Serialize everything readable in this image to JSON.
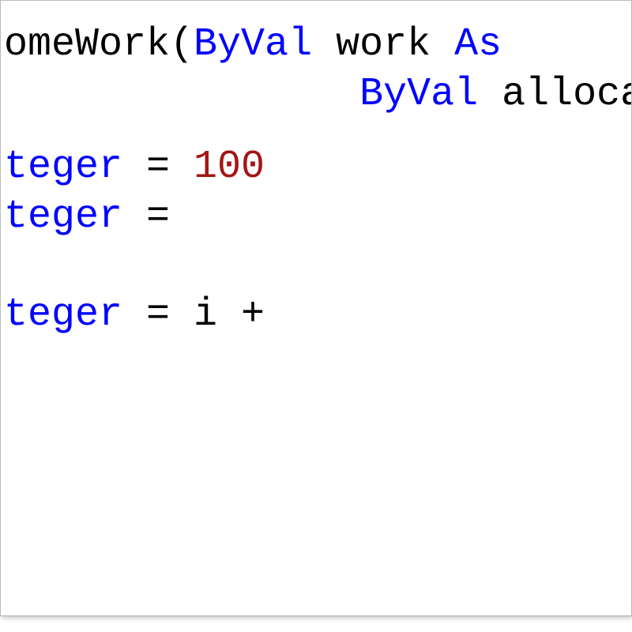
{
  "code": {
    "line1": {
      "part1": "omeWork(",
      "byval": "ByVal",
      "part2": " work ",
      "as": "As"
    },
    "line2": {
      "indent": "               ",
      "byval": "ByVal",
      "part2": " allocat"
    },
    "line3": {
      "type": "teger",
      "equals": " = ",
      "value": "100"
    },
    "line4": {
      "type": "teger",
      "equals": " = "
    },
    "line5": {
      "type": "teger",
      "equals": " = i + "
    }
  }
}
